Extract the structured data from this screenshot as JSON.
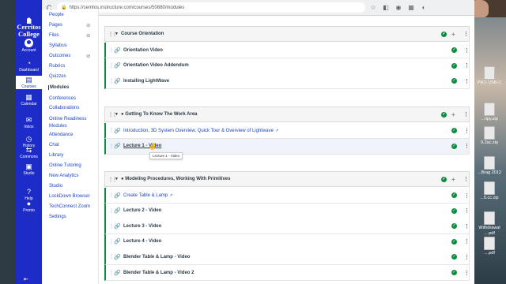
{
  "browser": {
    "url": "https://cerritos.instructure.com/courses/50880/modules",
    "back": "←",
    "forward": "→",
    "reload": "C"
  },
  "logo": {
    "line1": "Cerritos",
    "line2": "College"
  },
  "global_nav": [
    {
      "label": "Account",
      "icon": "account-icon"
    },
    {
      "label": "Dashboard",
      "icon": "dashboard-icon",
      "glyph": "◔"
    },
    {
      "label": "Courses",
      "icon": "courses-icon",
      "glyph": "▤"
    },
    {
      "label": "Calendar",
      "icon": "calendar-icon",
      "glyph": "▦"
    },
    {
      "label": "Inbox",
      "icon": "inbox-icon",
      "glyph": "✉"
    },
    {
      "label": "History",
      "icon": "history-icon",
      "glyph": "◷"
    },
    {
      "label": "Commons",
      "icon": "commons-icon",
      "glyph": "⇆"
    },
    {
      "label": "Studio",
      "icon": "studio-icon",
      "glyph": "▣"
    },
    {
      "label": "Help",
      "icon": "help-icon",
      "glyph": "?"
    },
    {
      "label": "Pronto",
      "icon": "pronto-icon",
      "glyph": "●"
    }
  ],
  "course_nav": [
    {
      "label": "People"
    },
    {
      "label": "Pages",
      "hidden": true
    },
    {
      "label": "Files",
      "hidden": true
    },
    {
      "label": "Syllabus"
    },
    {
      "label": "Outcomes",
      "hidden": true
    },
    {
      "label": "Rubrics"
    },
    {
      "label": "Quizzes"
    },
    {
      "label": "Modules"
    },
    {
      "label": "Conferences"
    },
    {
      "label": "Collaborations"
    },
    {
      "label": "Online Readiness"
    },
    {
      "label": "Modules"
    },
    {
      "label": "Attendance"
    },
    {
      "label": "Chat"
    },
    {
      "label": "Library"
    },
    {
      "label": "Online Tutoring"
    },
    {
      "label": "New Analytics"
    },
    {
      "label": "Studio"
    },
    {
      "label": "LockDown Browser"
    },
    {
      "label": "TechConnect Zoom"
    },
    {
      "label": "Settings"
    }
  ],
  "modules": [
    {
      "title": "Course Orientation",
      "items": [
        {
          "title": "Orientation Video",
          "style": "bold"
        },
        {
          "title": "Orientation Video Addendum",
          "style": "bold"
        },
        {
          "title": "Installing LightWave",
          "style": "bold"
        }
      ]
    },
    {
      "title": "● Getting To Know The Work Area",
      "items": [
        {
          "title": "Introduction, 3D System Overview, Quick Tour & Overview of Lightwave",
          "style": "link",
          "external": true
        },
        {
          "title": "Lecture 1 - Video",
          "style": "hover"
        }
      ]
    },
    {
      "title": "● Modeling Procedures, Working With Primitives",
      "items": [
        {
          "title": "Create Table & Lamp",
          "style": "link",
          "external": true
        },
        {
          "title": "Lecture 2 - Video",
          "style": "bold"
        },
        {
          "title": "Lecture 3 - Video",
          "style": "bold"
        },
        {
          "title": "Lecture 4 - Video",
          "style": "bold"
        },
        {
          "title": "Blender Table & Lamp - Video",
          "style": "bold"
        },
        {
          "title": "Blender Table & Lamp - Video 2",
          "style": "bold"
        }
      ]
    }
  ],
  "tooltip": "Lecture 1 - Video",
  "desktop_files": [
    {
      "label": "PRO USB-C"
    },
    {
      "label": "...ripy.zip"
    },
    {
      "label": "9.2ac.zip"
    },
    {
      "label": "...Brag 2012"
    },
    {
      "label": "...5.cc.zip"
    },
    {
      "label": "Withdrawal ....pdf"
    },
    {
      "label": "....pdf"
    }
  ],
  "colors": {
    "nav": "#1d2bc7",
    "published": "#0a8d3c",
    "link": "#1d45c7"
  }
}
